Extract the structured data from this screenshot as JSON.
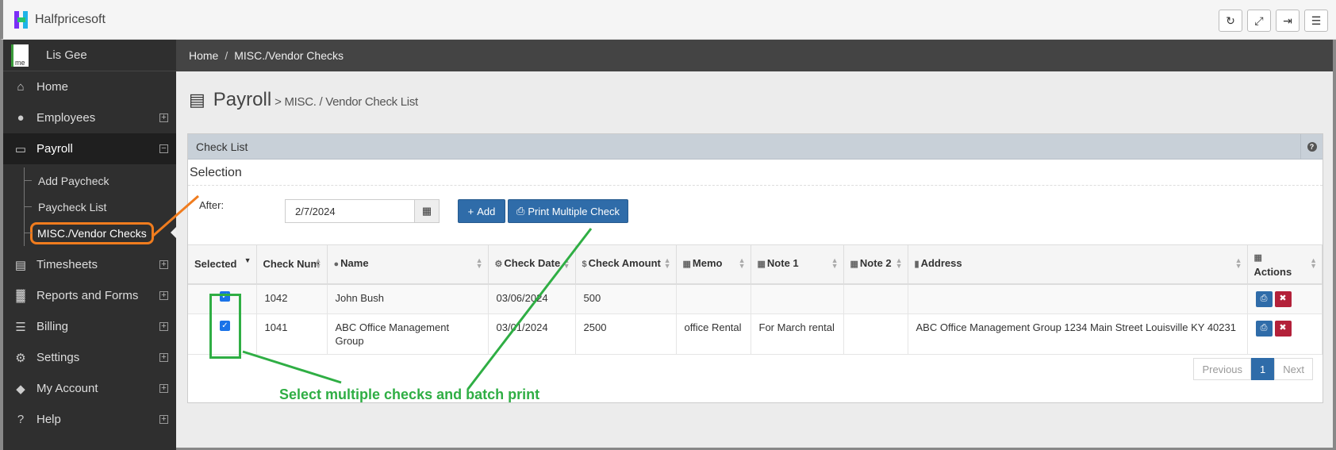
{
  "app": {
    "title": "Halfpricesoft"
  },
  "topbar": {
    "buttons": [
      "refresh-icon",
      "fullscreen-icon",
      "logout-icon",
      "menu-icon"
    ]
  },
  "user": {
    "name": "Lis Gee",
    "avatar_alt": "me"
  },
  "sidebar": {
    "items": [
      {
        "label": "Home",
        "icon": "home-icon"
      },
      {
        "label": "Employees",
        "icon": "user-icon"
      },
      {
        "label": "Payroll",
        "icon": "monitor-icon"
      },
      {
        "label": "Timesheets",
        "icon": "book-icon"
      },
      {
        "label": "Reports and Forms",
        "icon": "chart-icon"
      },
      {
        "label": "Billing",
        "icon": "cart-icon"
      },
      {
        "label": "Settings",
        "icon": "gears-icon"
      },
      {
        "label": "My Account",
        "icon": "tag-icon"
      },
      {
        "label": "Help",
        "icon": "question-icon"
      }
    ],
    "payroll_sub": [
      {
        "label": "Add Paycheck"
      },
      {
        "label": "Paycheck List"
      },
      {
        "label": "MISC./Vendor Checks"
      }
    ]
  },
  "breadcrumb": {
    "home": "Home",
    "sep": "/",
    "current": "MISC./Vendor Checks"
  },
  "page": {
    "title": "Payroll",
    "subtitle": "> MISC. / Vendor Check List"
  },
  "panel": {
    "title": "Check List",
    "selection_title": "Selection"
  },
  "filter": {
    "after_label": "After:",
    "date_value": "2/7/2024"
  },
  "buttons": {
    "add": "Add",
    "print_multiple": "Print Multiple Check"
  },
  "table": {
    "headers": {
      "selected": "Selected",
      "check_num": "Check Num",
      "name": "Name",
      "check_date": "Check Date",
      "check_amount": "Check Amount",
      "memo": "Memo",
      "note1": "Note 1",
      "note2": "Note 2",
      "address": "Address",
      "actions": "Actions"
    },
    "rows": [
      {
        "selected": true,
        "check_num": "1042",
        "name": "John Bush",
        "check_date": "03/06/2024",
        "check_amount": "500",
        "memo": "",
        "note1": "",
        "note2": "",
        "address": ""
      },
      {
        "selected": true,
        "check_num": "1041",
        "name": "ABC Office Management Group",
        "check_date": "03/01/2024",
        "check_amount": "2500",
        "memo": "office Rental",
        "note1": "For March rental",
        "note2": "",
        "address": "ABC Office Management Group   1234 Main Street   Louisville KY 40231"
      }
    ]
  },
  "pagination": {
    "previous": "Previous",
    "current": "1",
    "next": "Next"
  },
  "annotation": {
    "text": "Select multiple checks and batch print",
    "color": "#2fae44",
    "highlight_color": "#f07c1e"
  },
  "colors": {
    "primary": "#2f6ca9",
    "danger": "#b3213a",
    "sidebar": "#2f2f2f"
  }
}
